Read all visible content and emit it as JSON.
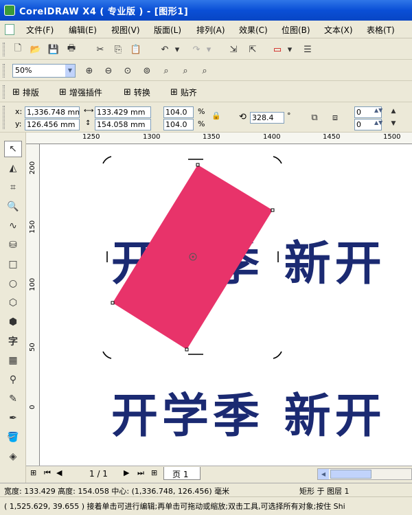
{
  "window": {
    "title": "CorelDRAW X4 ( 专业版 ) - [图形1]"
  },
  "menu": [
    "文件(F)",
    "编辑(E)",
    "视图(V)",
    "版面(L)",
    "排列(A)",
    "效果(C)",
    "位图(B)",
    "文本(X)",
    "表格(T)"
  ],
  "zoom": {
    "value": "50%"
  },
  "plugin_bar": {
    "layout": "排版",
    "enhance": "增强插件",
    "convert": "转换",
    "align": "贴齐"
  },
  "properties": {
    "x_label": "x:",
    "y_label": "y:",
    "x": "1,336.748 mm",
    "y": "126.456 mm",
    "width": "133.429 mm",
    "height": "154.058 mm",
    "scale_x": "104.0",
    "scale_y": "104.0",
    "percent": "%",
    "angle": "328.4",
    "degree": "°",
    "corner_a": "0",
    "corner_b": "0"
  },
  "ruler": {
    "top_ticks": [
      "1250",
      "1300",
      "1350",
      "1400",
      "1450",
      "1500"
    ],
    "left_ticks": [
      "200",
      "150",
      "100",
      "50",
      "0"
    ]
  },
  "canvas": {
    "headline": "开学季 新开",
    "headline_repeat": "开学季 新开",
    "rect_color": "#e8336a",
    "text_color": "#1b2a72"
  },
  "page_nav": {
    "counter": "1 / 1",
    "tab": "页 1"
  },
  "status": {
    "line1_left": "宽度: 133.429  高度: 154.058  中心: (1,336.748, 126.456)  毫米",
    "line1_right": "矩形 于 图层 1",
    "line2": "( 1,525.629, 39.655 )   接着单击可进行编辑;再单击可拖动或缩放;双击工具,可选择所有对象;按住 Shi"
  }
}
